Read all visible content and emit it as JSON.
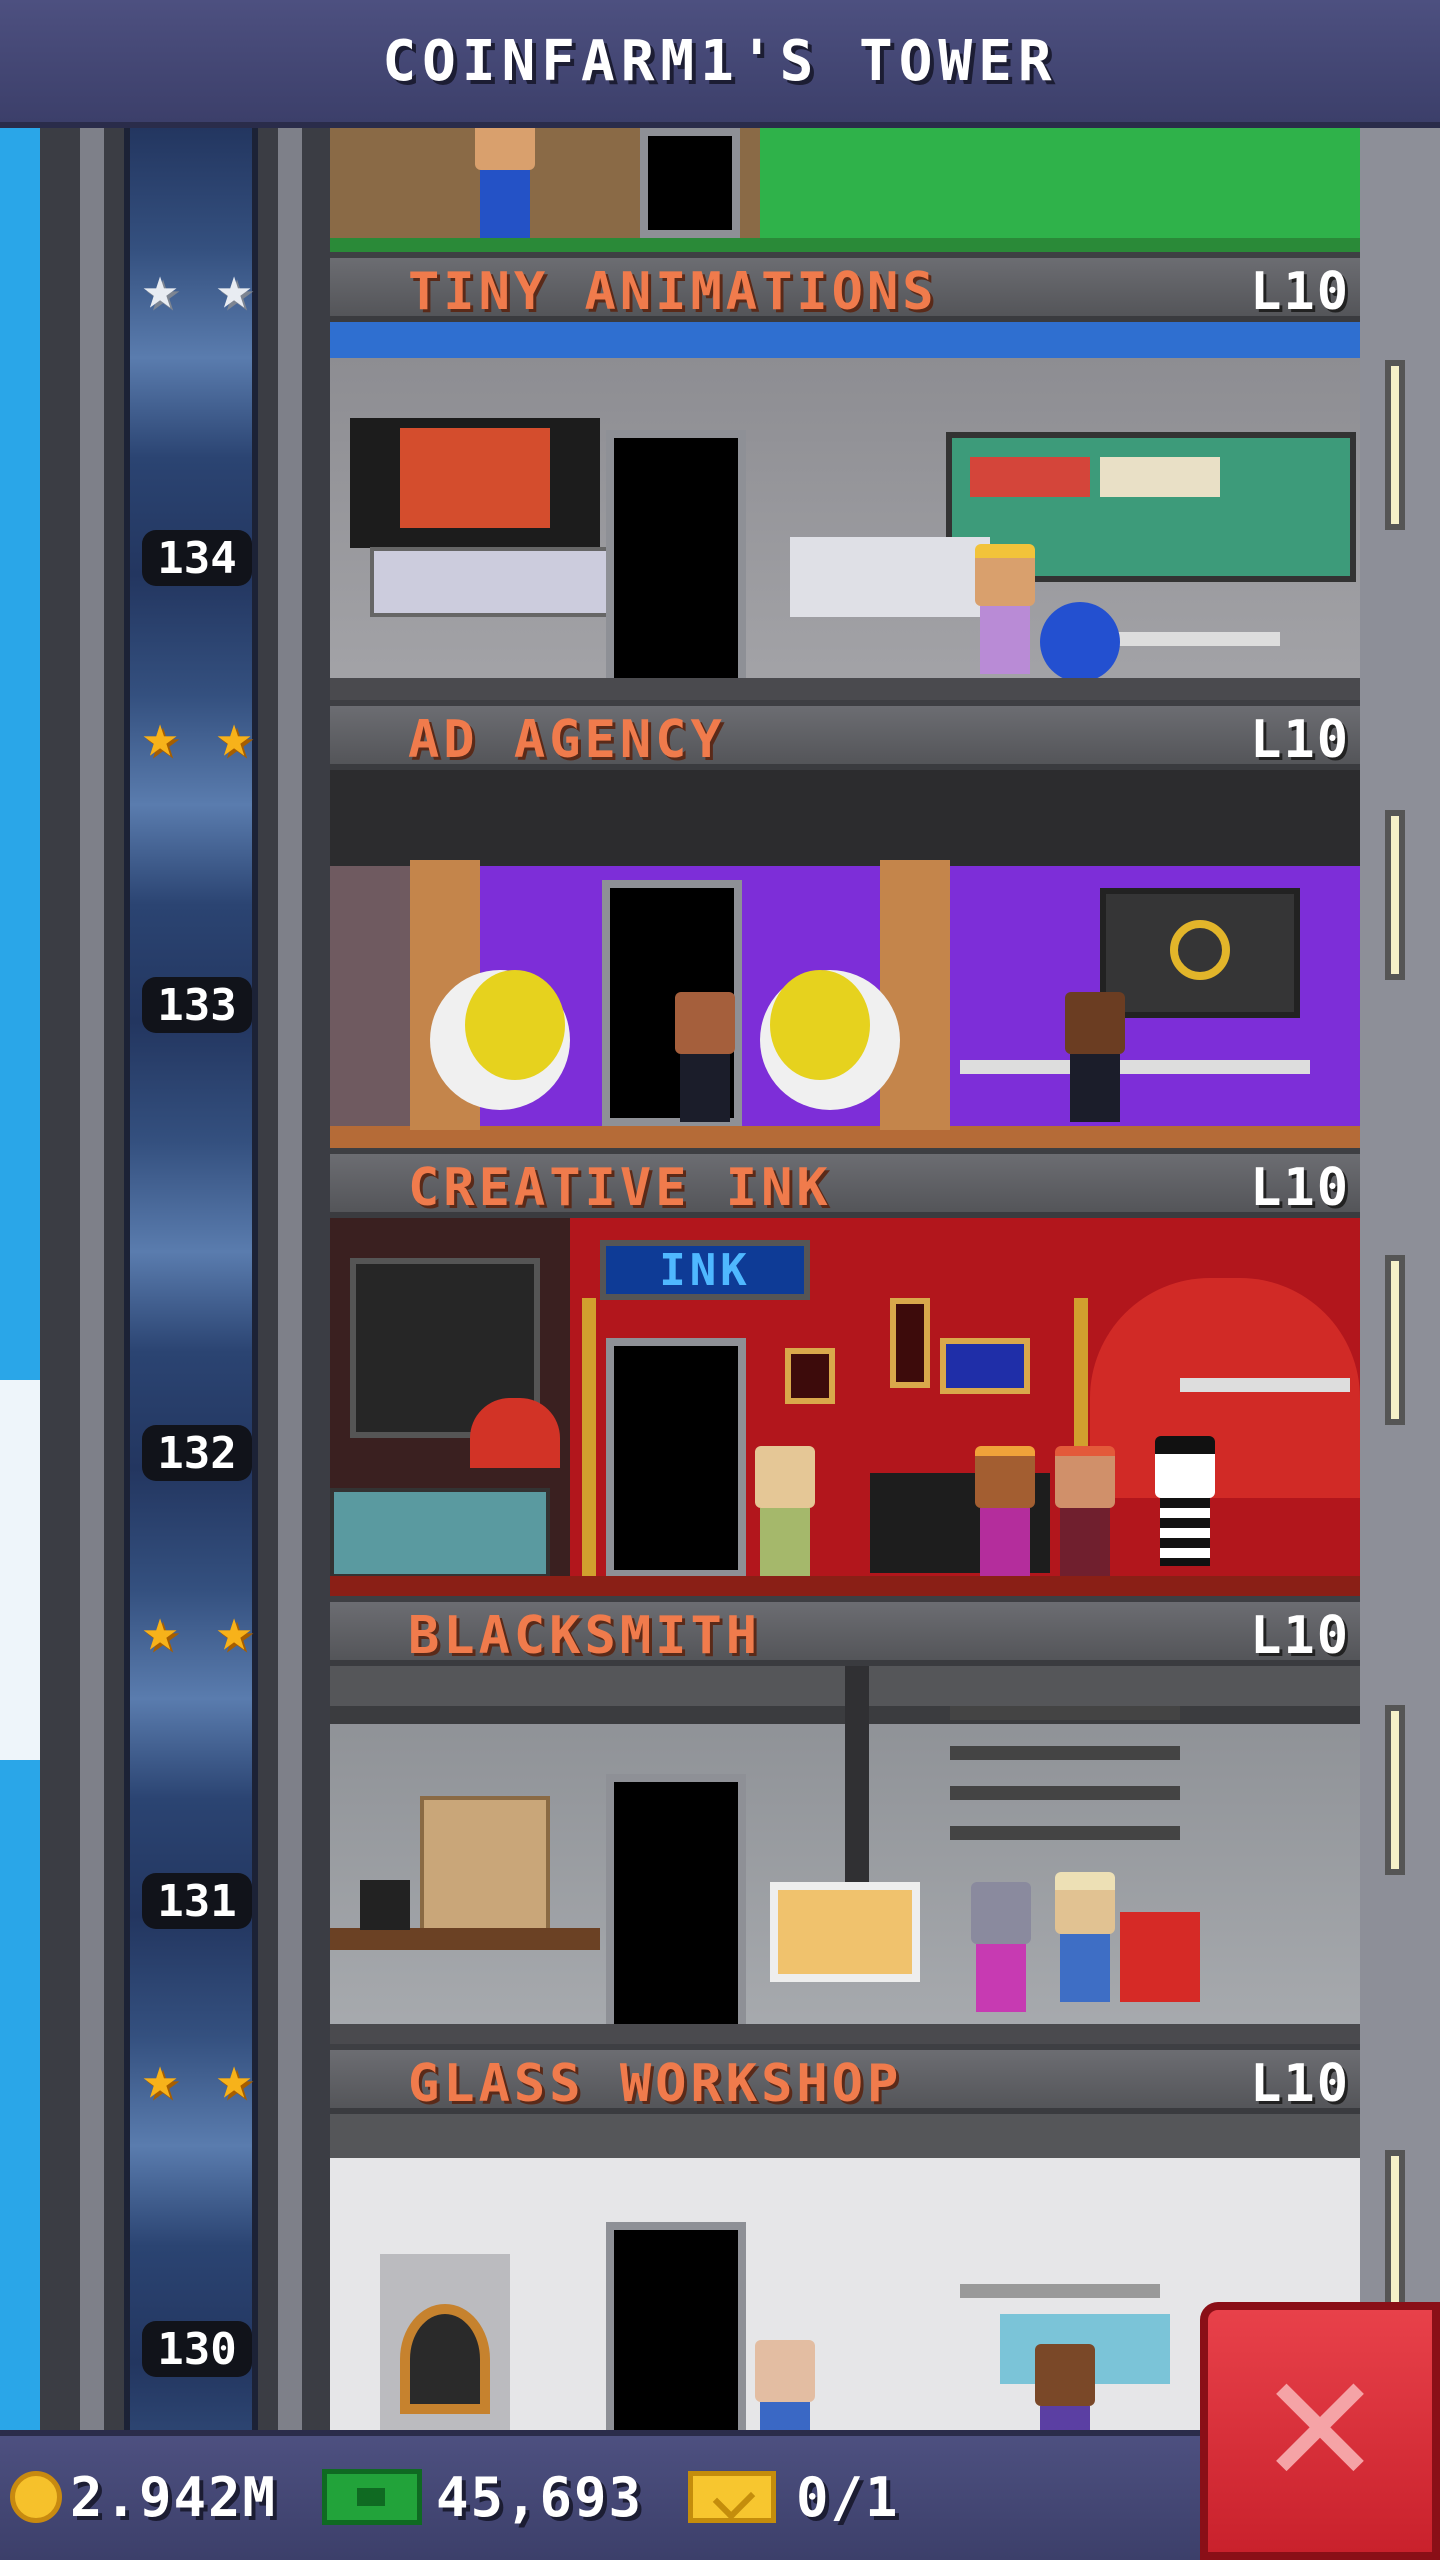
{
  "header": {
    "title": "COINFARM1'S TOWER"
  },
  "floors": [
    {
      "number": "134",
      "name": "TINY ANIMATIONS",
      "level": "L10",
      "stars": 2,
      "star_color": "silver"
    },
    {
      "number": "133",
      "name": "AD AGENCY",
      "level": "L10",
      "stars": 2,
      "star_color": "gold"
    },
    {
      "number": "132",
      "name": "CREATIVE INK",
      "level": "L10",
      "stars": 0,
      "star_color": "none"
    },
    {
      "number": "131",
      "name": "BLACKSMITH",
      "level": "L10",
      "stars": 2,
      "star_color": "gold"
    },
    {
      "number": "130",
      "name": "GLASS WORKSHOP",
      "level": "L10",
      "stars": 2,
      "star_color": "gold"
    }
  ],
  "room_signs": {
    "ink_sign": "INK"
  },
  "currency": {
    "coins": "2.942M",
    "bux": "45,693",
    "tickets": "0/1",
    "coin_icon": "coin-icon",
    "bux_icon": "bux-icon",
    "ticket_icon": "ticket-icon"
  },
  "close_button": {
    "icon": "close-icon",
    "color": "#d02a33"
  },
  "colors": {
    "header_bg": "#45486f",
    "floor_name": "#f07b4c",
    "sky": "#2aa6e8",
    "star_gold": "#f7b21a"
  }
}
